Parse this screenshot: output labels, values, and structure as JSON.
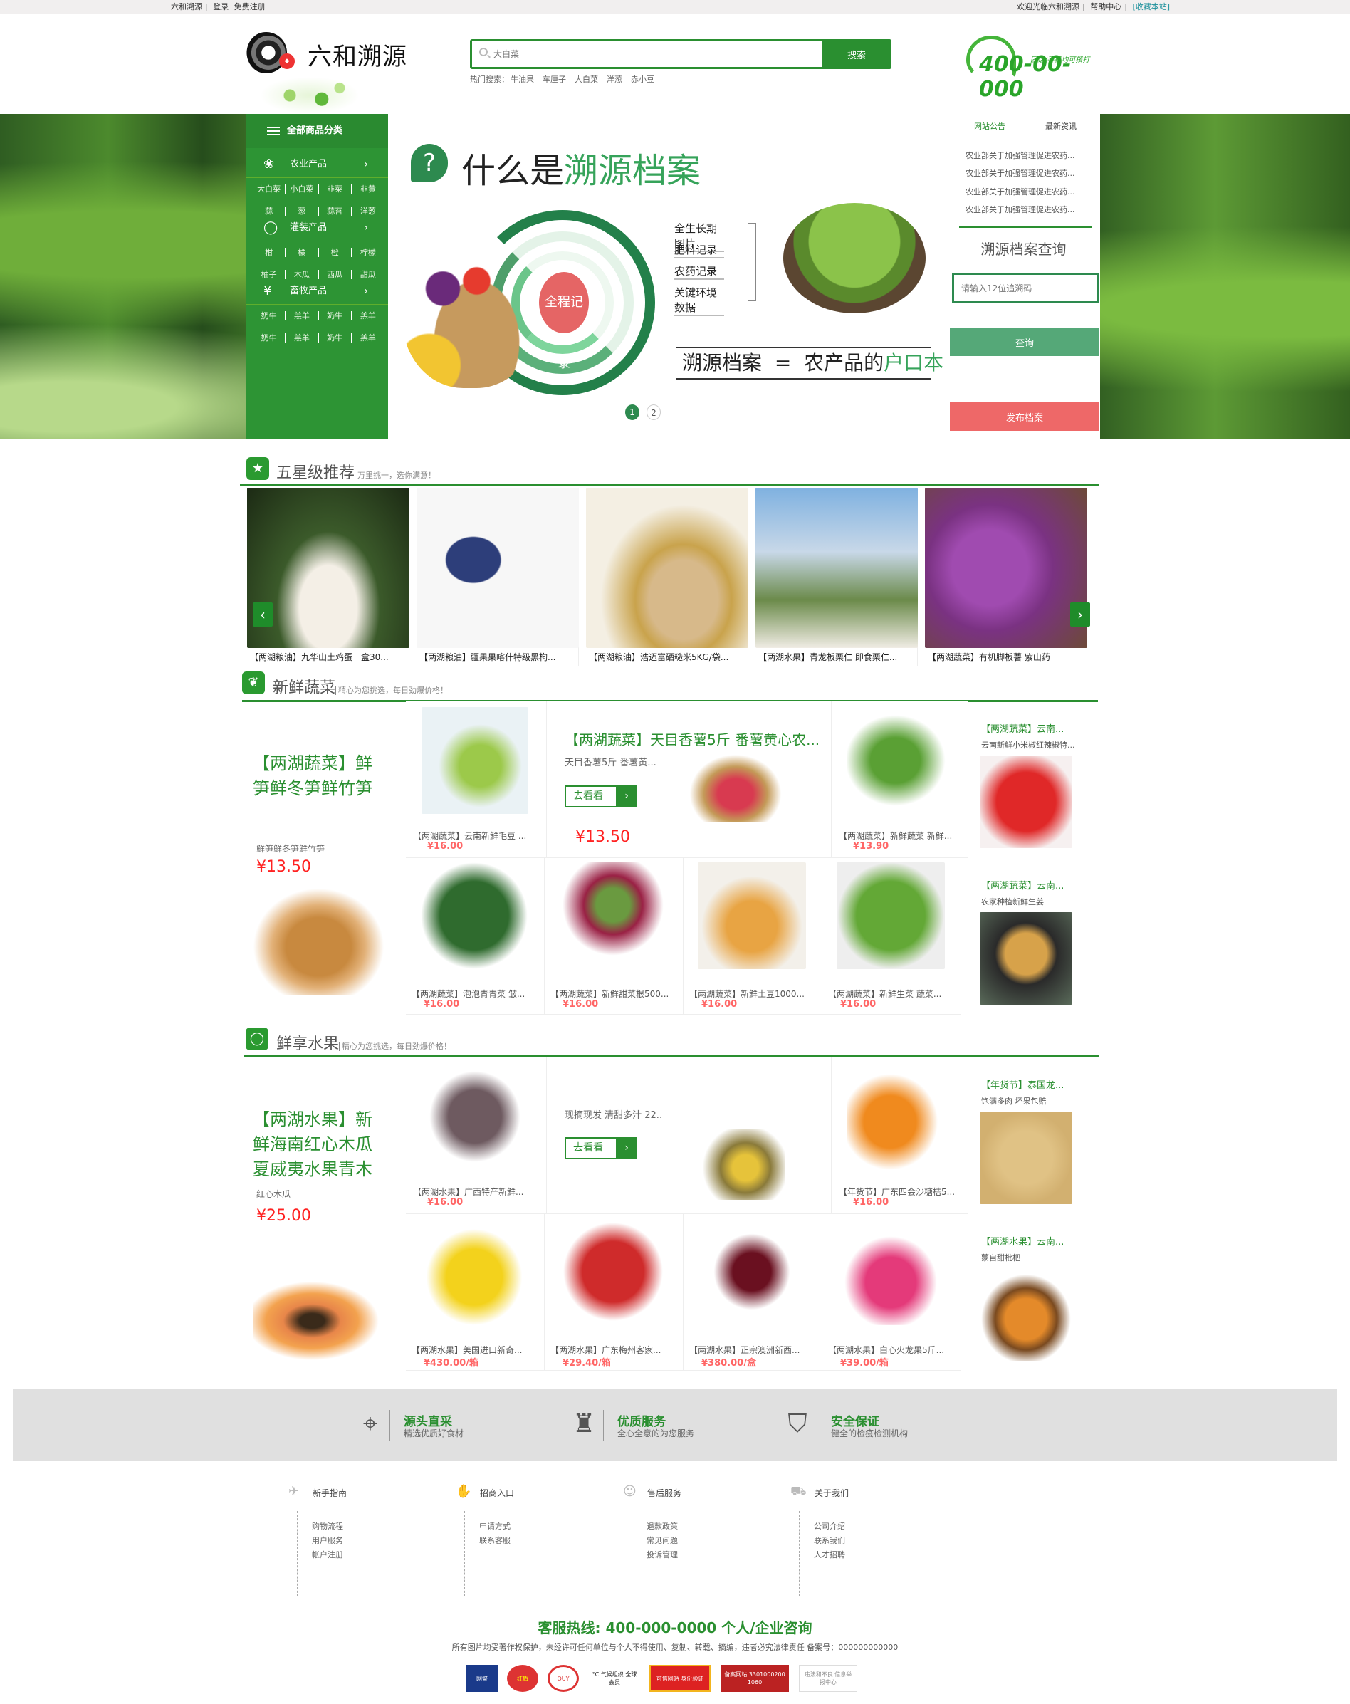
{
  "topbar": {
    "left": [
      "六和溯源",
      "登录",
      "免费注册"
    ],
    "right": [
      "欢迎光临六和溯源",
      "帮助中心",
      "[收藏本站]"
    ]
  },
  "header": {
    "logo_text": "六和溯源",
    "search_placeholder": "大白菜",
    "search_button": "搜索",
    "hot_label": "热门搜索：",
    "hot_terms": [
      "牛油果",
      "车厘子",
      "大白菜",
      "洋葱",
      "赤小豆"
    ],
    "phone_number": "400-00-000",
    "phone_note": "固话/手机均可拨打"
  },
  "sidebar": {
    "title": "全部商品分类",
    "groups": [
      {
        "label": "农业产品",
        "icon": "vegetable-icon",
        "items": [
          "大白菜",
          "小白菜",
          "韭菜",
          "韭黄",
          "蒜",
          "葱",
          "蒜苔",
          "洋葱"
        ]
      },
      {
        "label": "灌装产品",
        "icon": "apple-icon",
        "items": [
          "柑",
          "橘",
          "橙",
          "柠檬",
          "柚子",
          "木瓜",
          "西瓜",
          "甜瓜"
        ]
      },
      {
        "label": "畜牧产品",
        "icon": "wheat-icon",
        "items": [
          "奶牛",
          "羔羊",
          "奶牛",
          "羔羊",
          "奶牛",
          "羔羊",
          "奶牛",
          "羔羊"
        ]
      }
    ]
  },
  "banner": {
    "title_prefix": "什么是",
    "title_highlight": "溯源档案",
    "center_label": "全程记录",
    "labels": [
      "全生长期图片",
      "肥料记录",
      "农药记录",
      "关键环境数据"
    ],
    "equation_left": "溯源档案",
    "equation_sign": "=",
    "equation_right": "农产品的",
    "equation_highlight": "户口本",
    "pages": [
      "1",
      "2"
    ],
    "active_page": 1
  },
  "right_panel": {
    "tabs": [
      "网站公告",
      "最新资讯"
    ],
    "news": [
      "农业部关于加强管理促进农药...",
      "农业部关于加强管理促进农药...",
      "农业部关于加强管理促进农药...",
      "农业部关于加强管理促进农药..."
    ],
    "query_title": "溯源档案查询",
    "query_placeholder": "请输入12位追溯码",
    "query_button": "查询",
    "publish_button": "发布档案"
  },
  "recommend": {
    "title": "五星级推荐",
    "subtitle": "万里挑一，选你满意！",
    "items": [
      "【两湖粮油】九华山土鸡蛋一盒30...",
      "【两湖粮油】疆果果喀什特级黑枸...",
      "【两湖粮油】浩迈富硒糙米5KG/袋...",
      "【两湖水果】青龙板栗仁 即食栗仁...",
      "【两湖蔬菜】有机脚板薯 紫山药"
    ]
  },
  "vegetables": {
    "title": "新鲜蔬菜",
    "subtitle": "精心为您挑选，每日劲爆价格！",
    "lead": {
      "title": "【两湖蔬菜】鲜笋鲜冬笋鲜竹笋",
      "desc": "鲜笋鲜冬笋鲜竹笋",
      "price": "¥13.50"
    },
    "feature": {
      "title": "【两湖蔬菜】天目香薯5斤 番薯黄心农...",
      "desc": "天目香薯5斤 番薯黄...",
      "button": "去看看",
      "price": "¥13.50"
    },
    "row1": [
      {
        "name": "【两湖蔬菜】云南新鲜毛豆 ...",
        "price": "¥16.00"
      },
      {
        "name": "【两湖蔬菜】新鲜蔬菜 新鲜...",
        "price": "¥13.90"
      }
    ],
    "row2": [
      {
        "name": "【两湖蔬菜】泡泡青青菜 皱...",
        "price": "¥16.00"
      },
      {
        "name": "【两湖蔬菜】新鲜甜菜根500...",
        "price": "¥16.00"
      },
      {
        "name": "【两湖蔬菜】新鲜土豆1000...",
        "price": "¥16.00"
      },
      {
        "name": "【两湖蔬菜】新鲜生菜 蔬菜...",
        "price": "¥16.00"
      }
    ],
    "side": [
      {
        "title": "【两湖蔬菜】云南...",
        "desc": "云南新鲜小米椒红辣椒特..."
      },
      {
        "title": "【两湖蔬菜】云南...",
        "desc": "农家种植新鲜生姜"
      }
    ]
  },
  "fruits": {
    "title": "鲜享水果",
    "subtitle": "精心为您挑选，每日劲爆价格！",
    "lead": {
      "title": "【两湖水果】新鲜海南红心木瓜夏威夷水果青木",
      "desc": "红心木瓜",
      "price": "¥25.00"
    },
    "feature": {
      "title": "",
      "desc": "现摘现发 清甜多汁 22..",
      "button": "去看看"
    },
    "row1": [
      {
        "name": "【两湖水果】广西特产新鲜...",
        "price": "¥16.00"
      },
      {
        "name": "【年货节】广东四会沙糖桔5...",
        "price": "¥16.00"
      }
    ],
    "row2": [
      {
        "name": "【两湖水果】美国进口新奇...",
        "price": "¥430.00/箱"
      },
      {
        "name": "【两湖水果】广东梅州客家...",
        "price": "¥29.40/箱"
      },
      {
        "name": "【两湖水果】正宗澳洲新西...",
        "price": "¥380.00/盒"
      },
      {
        "name": "【两湖水果】白心火龙果5斤...",
        "price": "¥39.00/箱"
      }
    ],
    "side": [
      {
        "title": "【年货节】泰国龙...",
        "desc": "饱满多肉 坏果包赔"
      },
      {
        "title": "【两湖水果】云南...",
        "desc": "蒙自甜枇杷"
      }
    ]
  },
  "services": [
    {
      "title": "源头直采",
      "desc": "精选优质好食材",
      "icon": "location-pin-icon"
    },
    {
      "title": "优质服务",
      "desc": "全心全意的为您服务",
      "icon": "trophy-icon"
    },
    {
      "title": "安全保证",
      "desc": "健全的检疫检测机构",
      "icon": "shield-icon"
    }
  ],
  "footer": {
    "columns": [
      {
        "title": "新手指南",
        "icon": "paper-plane-icon",
        "links": [
          "购物流程",
          "用户服务",
          "帐户注册"
        ]
      },
      {
        "title": "招商入口",
        "icon": "handshake-icon",
        "links": [
          "申请方式",
          "联系客服"
        ]
      },
      {
        "title": "售后服务",
        "icon": "customer-service-icon",
        "links": [
          "退款政策",
          "常见问题",
          "投诉管理"
        ]
      },
      {
        "title": "关于我们",
        "icon": "truck-icon",
        "links": [
          "公司介绍",
          "联系我们",
          "人才招聘"
        ]
      }
    ],
    "hotline": "客服热线: 400-000-0000 个人/企业咨询",
    "copyright": "所有图片均受著作权保护，未经许可任何单位与个人不得使用、复制、转载、摘编，违者必究法律责任 备案号：000000000000",
    "badges": [
      "网警",
      "红盾",
      "QUY",
      "°C 气候组织 全球会员",
      "可信网站 身份验证",
      "备案网站 33010002001060",
      "违法和不良 信息举报中心"
    ]
  },
  "colors": {
    "brand_green": "#2a8f30",
    "query_green": "#55a878",
    "publish_red": "#ee6868",
    "price_red": "#ff6666"
  }
}
